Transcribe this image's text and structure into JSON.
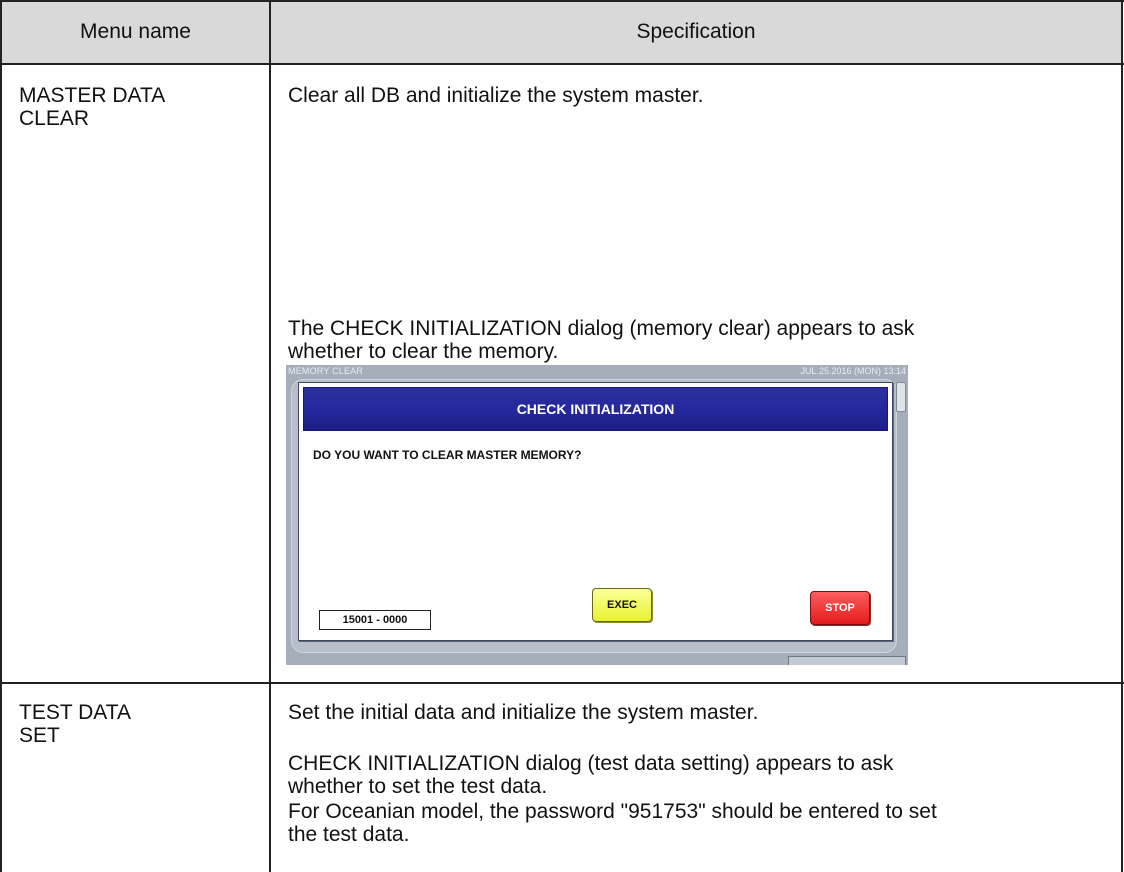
{
  "table": {
    "headers": [
      "Menu name",
      "Specification"
    ],
    "rows": [
      {
        "menu_name_line1": "MASTER DATA",
        "menu_name_line2": "CLEAR",
        "spec_line1": "Clear all DB and initialize the system master.",
        "spec_line2": "The CHECK INITIALIZATION dialog (memory clear) appears to ask",
        "spec_line3": "whether to clear the memory."
      },
      {
        "menu_name_line1": "TEST DATA",
        "menu_name_line2": "SET",
        "spec_line1": "Set the initial data and initialize the system master.",
        "spec_line2": "CHECK INITIALIZATION dialog (test data setting) appears to ask",
        "spec_line3": "whether to set the test data.",
        "spec_line4": "For Oceanian model, the password \"951753\" should be entered to set",
        "spec_line5": "the test data."
      }
    ]
  },
  "device_screen": {
    "screen_title": "MEMORY CLEAR",
    "datetime": "JUL.25.2016 (MON)  13:14",
    "dialog_title": "CHECK INITIALIZATION",
    "dialog_message": "DO YOU WANT TO CLEAR MASTER MEMORY?",
    "code_display": "15001 - 0000",
    "exec_label": "EXEC",
    "stop_label": "STOP"
  },
  "colors": {
    "dialog_header": "#24279a",
    "exec_button": "#f2f75a",
    "stop_button": "#ee2b2b",
    "device_background": "#a6aeb9"
  }
}
